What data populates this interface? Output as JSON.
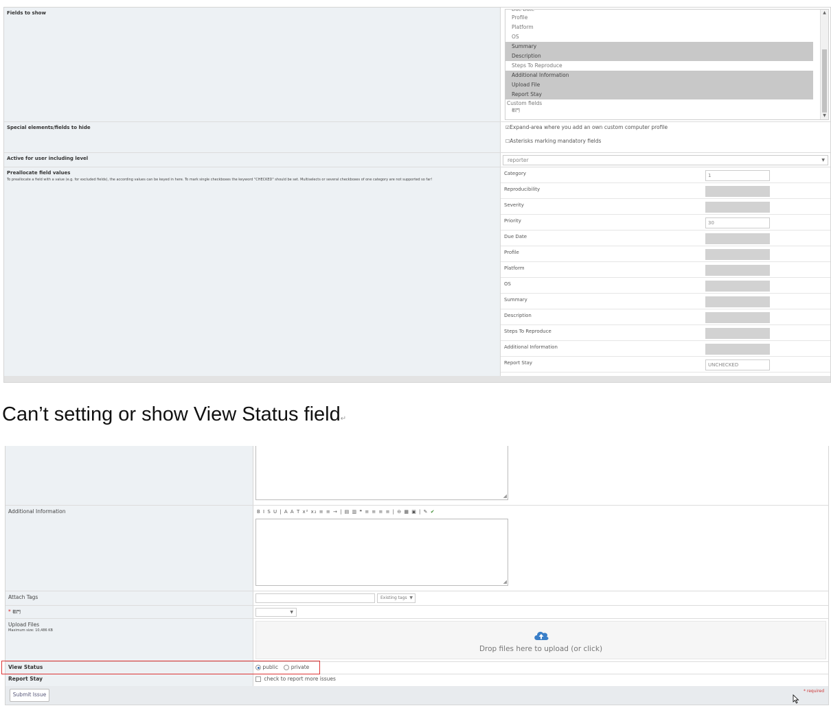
{
  "panel1": {
    "fields_to_show": {
      "label": "Fields to show",
      "partial_top": "Due Date",
      "items": [
        {
          "label": "Profile",
          "selected": false
        },
        {
          "label": "Platform",
          "selected": false
        },
        {
          "label": "OS",
          "selected": false
        },
        {
          "label": "Summary",
          "selected": true
        },
        {
          "label": "Description",
          "selected": true
        },
        {
          "label": "Steps To Reproduce",
          "selected": false
        },
        {
          "label": "Additional Information",
          "selected": true
        },
        {
          "label": "Upload File",
          "selected": true
        },
        {
          "label": "Report Stay",
          "selected": true
        }
      ],
      "group_label": "Custom fields",
      "custom_item": "都門"
    },
    "special": {
      "label": "Special elements/fields to hide",
      "opt1": "Expand-area where you add an own custom computer profile",
      "opt2": "Asterisks marking mandatory fields"
    },
    "active": {
      "label": "Active for user including level",
      "value": "reporter"
    },
    "preallocate": {
      "label": "Preallocate field values",
      "note": "To preallocate a field with a value (e.g. for excluded fields), the according values can be keyed in here. To mark single checkboxes the keyword \"CHECKED\" should be set. Multiselects or several checkboxes of one category are not supported so far!",
      "rows": [
        {
          "label": "Category",
          "value": "1"
        },
        {
          "label": "Reproducibility",
          "value": ""
        },
        {
          "label": "Severity",
          "value": ""
        },
        {
          "label": "Priority",
          "value": "30"
        },
        {
          "label": "Due Date",
          "value": ""
        },
        {
          "label": "Profile",
          "value": ""
        },
        {
          "label": "Platform",
          "value": ""
        },
        {
          "label": "OS",
          "value": ""
        },
        {
          "label": "Summary",
          "value": ""
        },
        {
          "label": "Description",
          "value": ""
        },
        {
          "label": "Steps To Reproduce",
          "value": ""
        },
        {
          "label": "Additional Information",
          "value": ""
        },
        {
          "label": "Report Stay",
          "value": "UNCHECKED"
        }
      ]
    }
  },
  "heading": "Can’t setting or show View Status field",
  "heading_mark": "↵",
  "panel2": {
    "additional_info": "Additional Information",
    "toolbar": "B I S U | A A T x² x₂ ≡ ≡ → | ▤ ▥ ❝ ≡ ≡ ≡ ≡ | ⊖ ▦ ▣ | ✎",
    "toolbar_ok": "✔",
    "attach_tags": "Attach Tags",
    "existing_tags": "Existing tags",
    "custom_required_mark": "*",
    "custom_label": "都門",
    "upload_files": "Upload Files",
    "max_size": "Maximum size: 10,486 KB",
    "drop_text": "Drop files here to upload (or click)",
    "view_status": "View Status",
    "public": "public",
    "private": "private",
    "report_stay": "Report Stay",
    "report_stay_check": "check to report more issues",
    "submit": "Submit Issue",
    "required": "* required"
  }
}
